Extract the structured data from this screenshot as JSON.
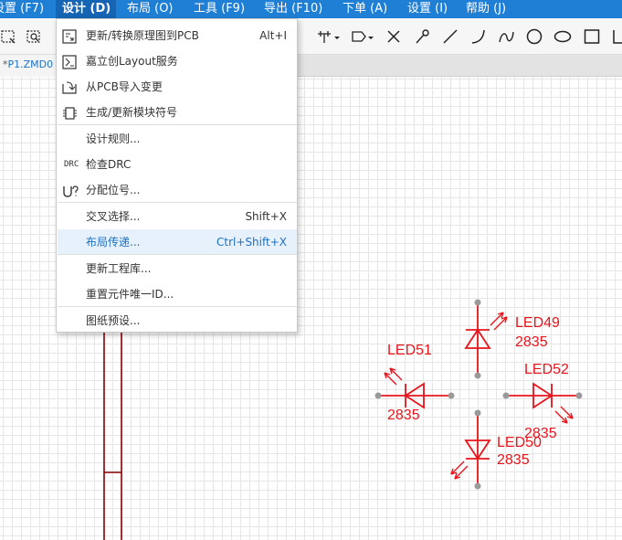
{
  "menubar": {
    "items": [
      {
        "label": "设置 (F7)"
      },
      {
        "label": "设计 (D)"
      },
      {
        "label": "布局 (O)"
      },
      {
        "label": "工具 (F9)"
      },
      {
        "label": "导出 (F10)"
      },
      {
        "label": "下单 (A)"
      },
      {
        "label": "设置 (I)"
      },
      {
        "label": "帮助 (J)"
      }
    ]
  },
  "tab": {
    "modified_marker": "*",
    "title": "P1.ZMD0"
  },
  "design_menu": {
    "items": [
      {
        "label": "更新/转换原理图到PCB",
        "shortcut": "Alt+I",
        "icon": "pcb-update-icon"
      },
      {
        "label": "嘉立创Layout服务",
        "shortcut": "",
        "icon": "layout-service-icon"
      },
      {
        "label": "从PCB导入变更",
        "shortcut": "",
        "icon": "import-changes-icon"
      },
      {
        "label": "生成/更新模块符号",
        "shortcut": "",
        "icon": "module-symbol-icon"
      },
      {
        "label": "设计规则...",
        "shortcut": ""
      },
      {
        "label": "检查DRC",
        "shortcut": "",
        "icon_text": "DRC"
      },
      {
        "label": "分配位号...",
        "shortcut": "",
        "icon": "designator-icon"
      },
      {
        "label": "交叉选择...",
        "shortcut": "Shift+X"
      },
      {
        "label": "布局传递...",
        "shortcut": "Ctrl+Shift+X"
      },
      {
        "label": "更新工程库...",
        "shortcut": ""
      },
      {
        "label": "重置元件唯一ID...",
        "shortcut": ""
      },
      {
        "label": "图纸预设...",
        "shortcut": ""
      }
    ],
    "highlighted_index": 8
  },
  "schematic": {
    "components": [
      {
        "designator": "LED49",
        "value": "2835"
      },
      {
        "designator": "LED51",
        "value": "2835"
      },
      {
        "designator": "LED52",
        "value": "2835"
      },
      {
        "designator": "LED50",
        "value": "2835"
      }
    ],
    "colors": {
      "symbol": "#e8141c",
      "wire": "#8a0000",
      "pin_dot": "#9a9a9a",
      "grid": "#e6e6e6",
      "menubar": "#1f7fd4"
    }
  }
}
